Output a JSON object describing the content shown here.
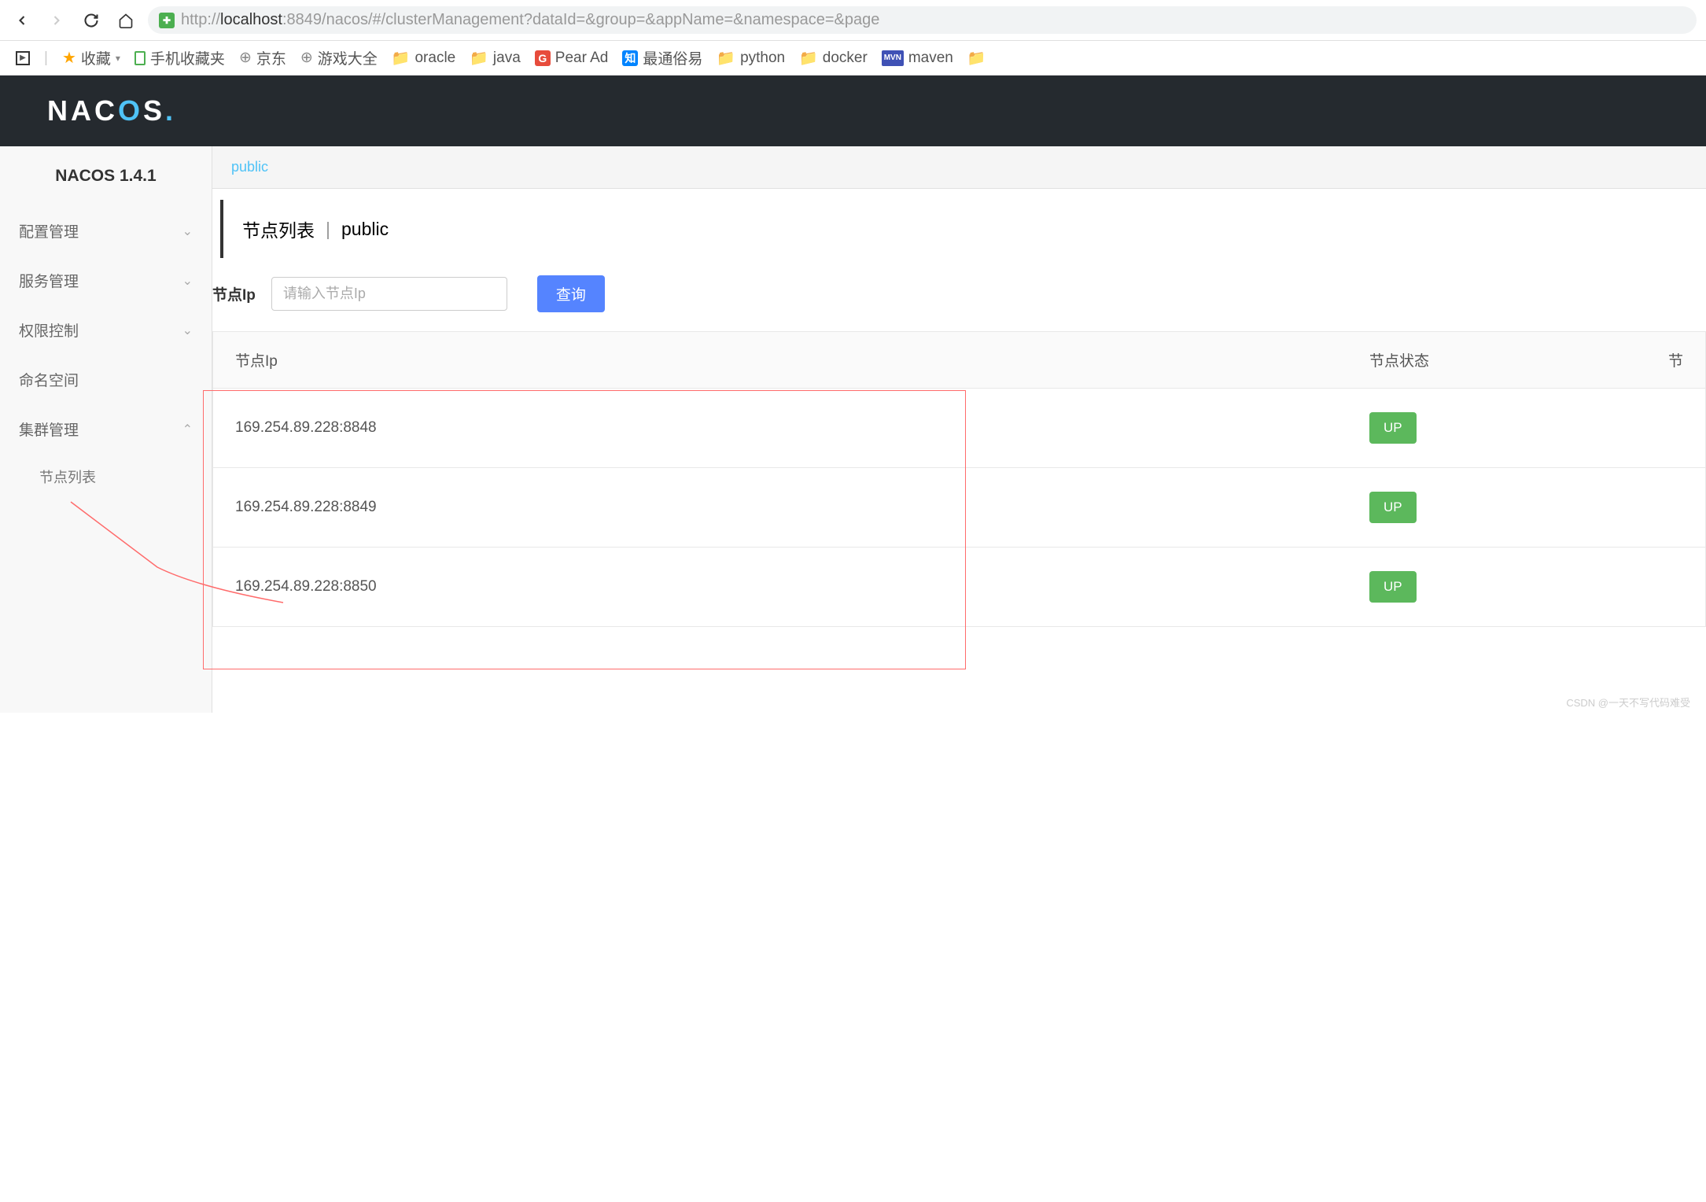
{
  "browser": {
    "url_prefix": "http://",
    "url_host": "localhost",
    "url_path": ":8849/nacos/#/clusterManagement?dataId=&group=&appName=&namespace=&page"
  },
  "bookmarks": {
    "favorites": "收藏",
    "mobile_favs": "手机收藏夹",
    "jd": "京东",
    "games": "游戏大全",
    "oracle": "oracle",
    "java": "java",
    "pear": "Pear Ad",
    "tongsu": "最通俗易",
    "python": "python",
    "docker": "docker",
    "maven": "maven"
  },
  "header": {
    "logo": "NACOS"
  },
  "sidebar": {
    "version": "NACOS 1.4.1",
    "items": [
      {
        "label": "配置管理",
        "expanded": false
      },
      {
        "label": "服务管理",
        "expanded": false
      },
      {
        "label": "权限控制",
        "expanded": false
      },
      {
        "label": "命名空间",
        "expanded": false
      },
      {
        "label": "集群管理",
        "expanded": true
      }
    ],
    "subitems": {
      "cluster": "节点列表"
    }
  },
  "content": {
    "namespace_tab": "public",
    "page_title": "节点列表",
    "page_title_ns": "public",
    "search_label": "节点Ip",
    "search_placeholder": "请输入节点Ip",
    "search_button": "查询",
    "table": {
      "headers": {
        "ip": "节点Ip",
        "status": "节点状态",
        "extra": "节"
      },
      "rows": [
        {
          "ip": "169.254.89.228:8848",
          "status": "UP"
        },
        {
          "ip": "169.254.89.228:8849",
          "status": "UP"
        },
        {
          "ip": "169.254.89.228:8850",
          "status": "UP"
        }
      ]
    }
  },
  "watermark": "CSDN @一天不写代码难受"
}
